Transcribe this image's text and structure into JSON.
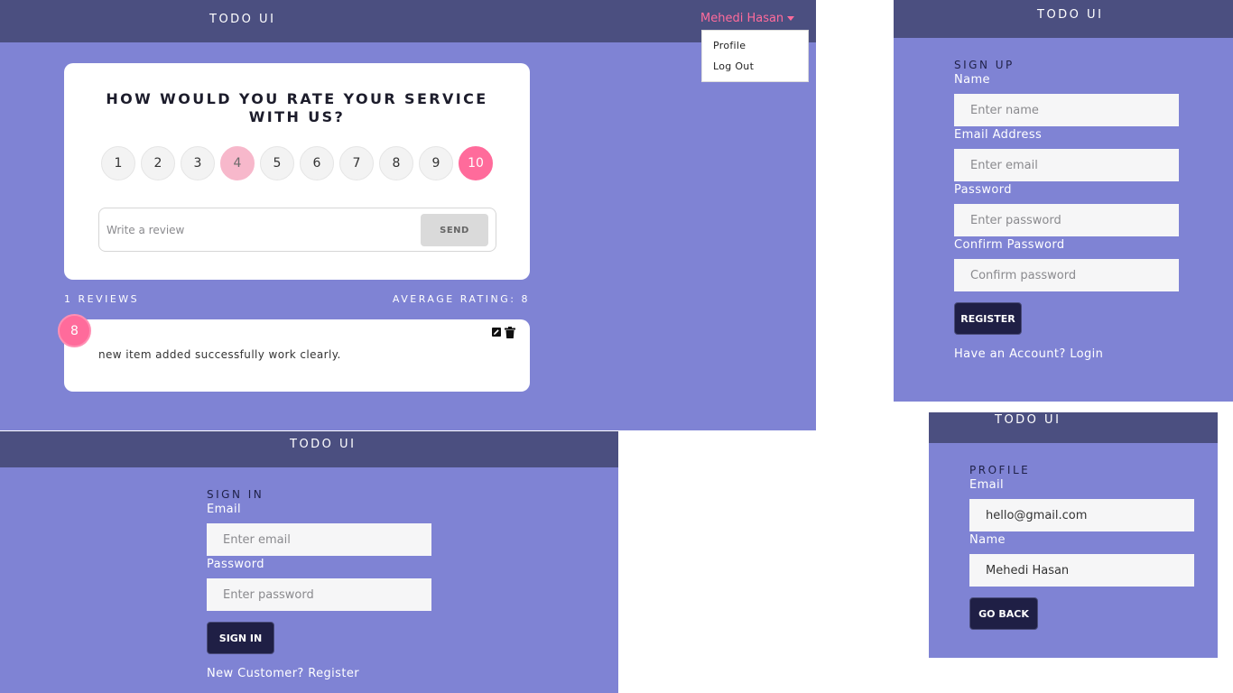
{
  "main": {
    "brand": "TODO UI",
    "user_name": "Mehedi Hasan",
    "dropdown": {
      "profile": "Profile",
      "logout": "Log Out"
    },
    "question": "HOW WOULD YOU RATE YOUR SERVICE WITH US?",
    "ratings": [
      "1",
      "2",
      "3",
      "4",
      "5",
      "6",
      "7",
      "8",
      "9",
      "10"
    ],
    "hovered_rating": 4,
    "selected_rating": 10,
    "review_placeholder": "Write a review",
    "send_label": "SEND",
    "reviews_count": "1 REVIEWS",
    "average_rating": "AVERAGE RATING: 8",
    "review": {
      "rating": "8",
      "text": "new item added successfully work clearly."
    },
    "colors": {
      "accent": "#ff6b9b",
      "panel": "#7f83d4",
      "navbar": "#4b4f80",
      "button": "#1f1f45"
    },
    "icons": {
      "edit": "edit-icon",
      "delete": "trash-icon"
    }
  },
  "signup": {
    "brand": "TODO UI",
    "title": "SIGN UP",
    "name_label": "Name",
    "name_placeholder": "Enter name",
    "email_label": "Email Address",
    "email_placeholder": "Enter email",
    "password_label": "Password",
    "password_placeholder": "Enter password",
    "confirm_label": "Confirm Password",
    "confirm_placeholder": "Confirm password",
    "register_label": "REGISTER",
    "login_link": "Have an Account? Login"
  },
  "signin": {
    "brand": "TODO UI",
    "title": "SIGN IN",
    "email_label": "Email",
    "email_placeholder": "Enter email",
    "password_label": "Password",
    "password_placeholder": "Enter password",
    "signin_label": "SIGN IN",
    "register_link": "New Customer? Register"
  },
  "profile": {
    "brand": "TODO UI",
    "title": "PROFILE",
    "email_label": "Email",
    "email_value": "hello@gmail.com",
    "name_label": "Name",
    "name_value": "Mehedi Hasan",
    "back_label": "GO BACK"
  }
}
